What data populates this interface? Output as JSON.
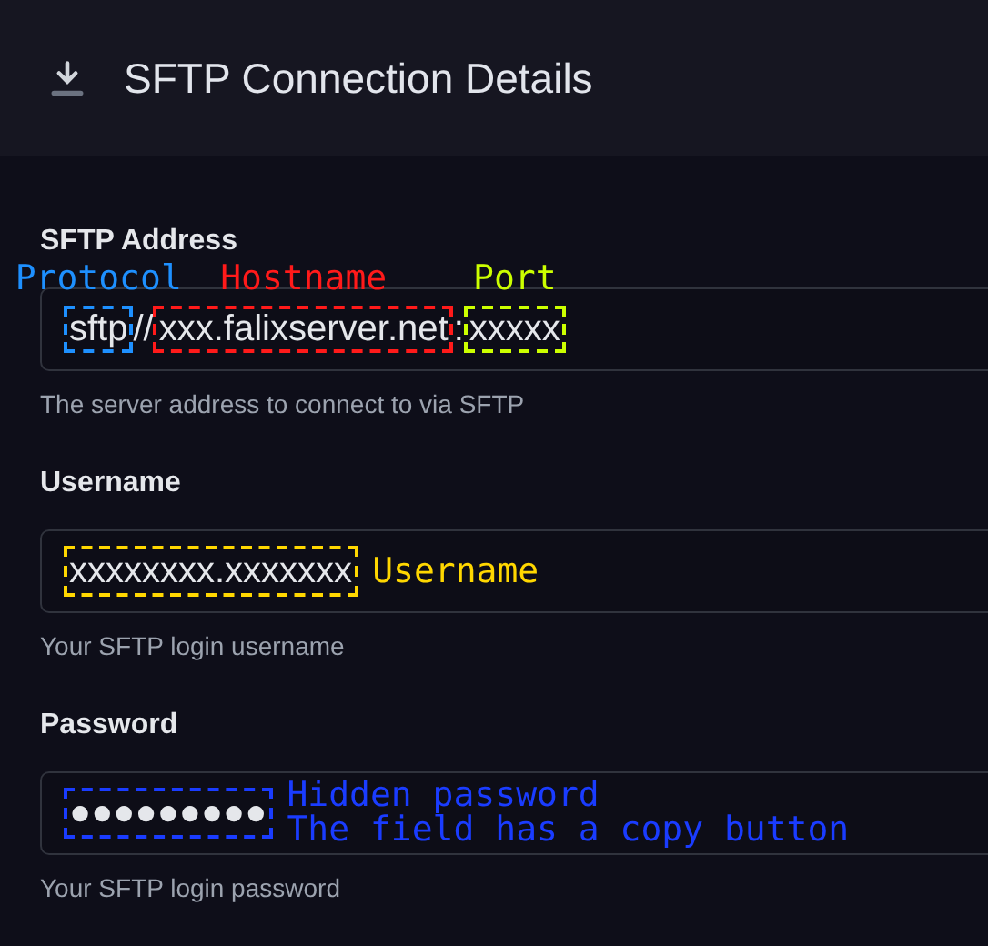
{
  "header": {
    "title": "SFTP Connection Details"
  },
  "fields": [
    {
      "kind": "address",
      "label": "SFTP Address",
      "hint": "The server address to connect to via SFTP",
      "segments": [
        {
          "text": "sftp",
          "annotation": [
            "Protocol"
          ],
          "color": "#1e90ff"
        },
        {
          "text": "//"
        },
        {
          "text": "xxx.falixserver.net",
          "annotation": [
            "Hostname"
          ],
          "color": "#ff1a1a"
        },
        {
          "text": ":"
        },
        {
          "text": "xxxxx",
          "annotation": [
            "Port"
          ],
          "color": "#ccff00"
        }
      ]
    },
    {
      "kind": "text",
      "label": "Username",
      "hint": "Your SFTP login username",
      "segments": [
        {
          "text": "xxxxxxxx.xxxxxxx",
          "annotation": [
            "Username"
          ],
          "color": "#ffd700"
        }
      ]
    },
    {
      "kind": "password",
      "label": "Password",
      "hint": "Your SFTP login password",
      "segments": [
        {
          "text": "●●●●●●●●●",
          "annotation": [
            "Hidden password",
            "The field has a copy button"
          ],
          "color": "#1a3cff"
        }
      ]
    }
  ]
}
